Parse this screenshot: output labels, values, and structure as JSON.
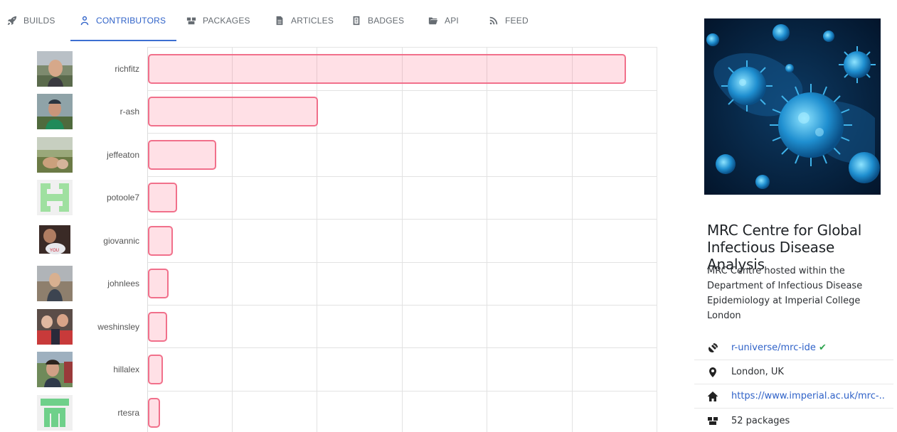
{
  "tabs": [
    {
      "label": "BUILDS",
      "icon": "rocket-icon"
    },
    {
      "label": "CONTRIBUTORS",
      "icon": "user-icon",
      "active": true
    },
    {
      "label": "PACKAGES",
      "icon": "boxes-icon"
    },
    {
      "label": "ARTICLES",
      "icon": "file-icon"
    },
    {
      "label": "BADGES",
      "icon": "badge-icon"
    },
    {
      "label": "API",
      "icon": "folder-icon"
    },
    {
      "label": "FEED",
      "icon": "rss-icon"
    }
  ],
  "chart_data": {
    "type": "bar",
    "orientation": "horizontal",
    "categories": [
      "richfitz",
      "r-ash",
      "jeffeaton",
      "potoole7",
      "giovannic",
      "johnlees",
      "weshinsley",
      "hillalex",
      "rtesra"
    ],
    "values": [
      2810,
      1000,
      400,
      170,
      145,
      120,
      112,
      88,
      70
    ],
    "xlim": [
      0,
      3000
    ],
    "grid": true
  },
  "colors": {
    "accent": "#3c6fd1",
    "bar_fill": "rgba(255,99,132,0.2)",
    "bar_border": "#f06482",
    "verified": "#2ea44f"
  },
  "org": {
    "name": "MRC Centre for Global Infectious Disease Analysis",
    "description": "MRC Centre hosted within the Department of Infectious Disease Epidemiology at Imperial College London",
    "universe": "r-universe/mrc-ide",
    "location": "London, UK",
    "homepage": "https://www.imperial.ac.uk/mrc-...",
    "packages": "52 packages"
  }
}
